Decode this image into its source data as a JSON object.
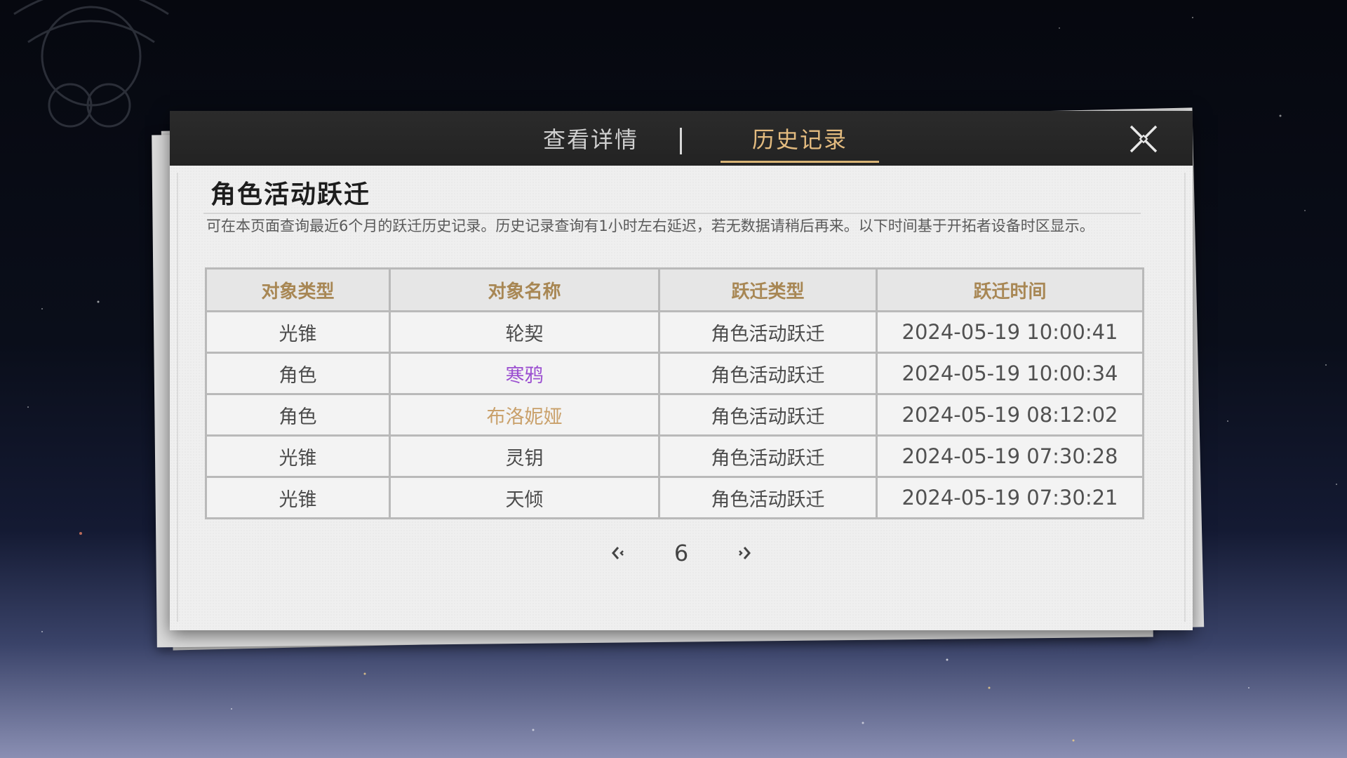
{
  "tabs": [
    {
      "label": "查看详情"
    },
    {
      "label": "历史记录"
    }
  ],
  "active_tab": 1,
  "title": "角色活动跃迁",
  "description": "可在本页面查询最近6个月的跃迁历史记录。历史记录查询有1小时左右延迟，若无数据请稍后再来。以下时间基于开拓者设备时区显示。",
  "table": {
    "headers": [
      "对象类型",
      "对象名称",
      "跃迁类型",
      "跃迁时间"
    ],
    "rows": [
      [
        "光锥",
        "轮契",
        "角色活动跃迁",
        "2024-05-19 10:00:41"
      ],
      [
        "角色",
        "寒鸦",
        "角色活动跃迁",
        "2024-05-19 10:00:34"
      ],
      [
        "角色",
        "布洛妮娅",
        "角色活动跃迁",
        "2024-05-19 08:12:02"
      ],
      [
        "光锥",
        "灵钥",
        "角色活动跃迁",
        "2024-05-19 07:30:28"
      ],
      [
        "光锥",
        "天倾",
        "角色活动跃迁",
        "2024-05-19 07:30:21"
      ]
    ]
  },
  "pagination": {
    "current_page": "6"
  },
  "colors": {
    "accent_gold": "#d9b476",
    "header_text": "#a88754",
    "rarity_5": "#c9a06a",
    "rarity_4": "#9b4fd0"
  },
  "icons": {
    "close": "close-icon",
    "prev": "chevron-left-icon",
    "next": "chevron-right-icon"
  }
}
